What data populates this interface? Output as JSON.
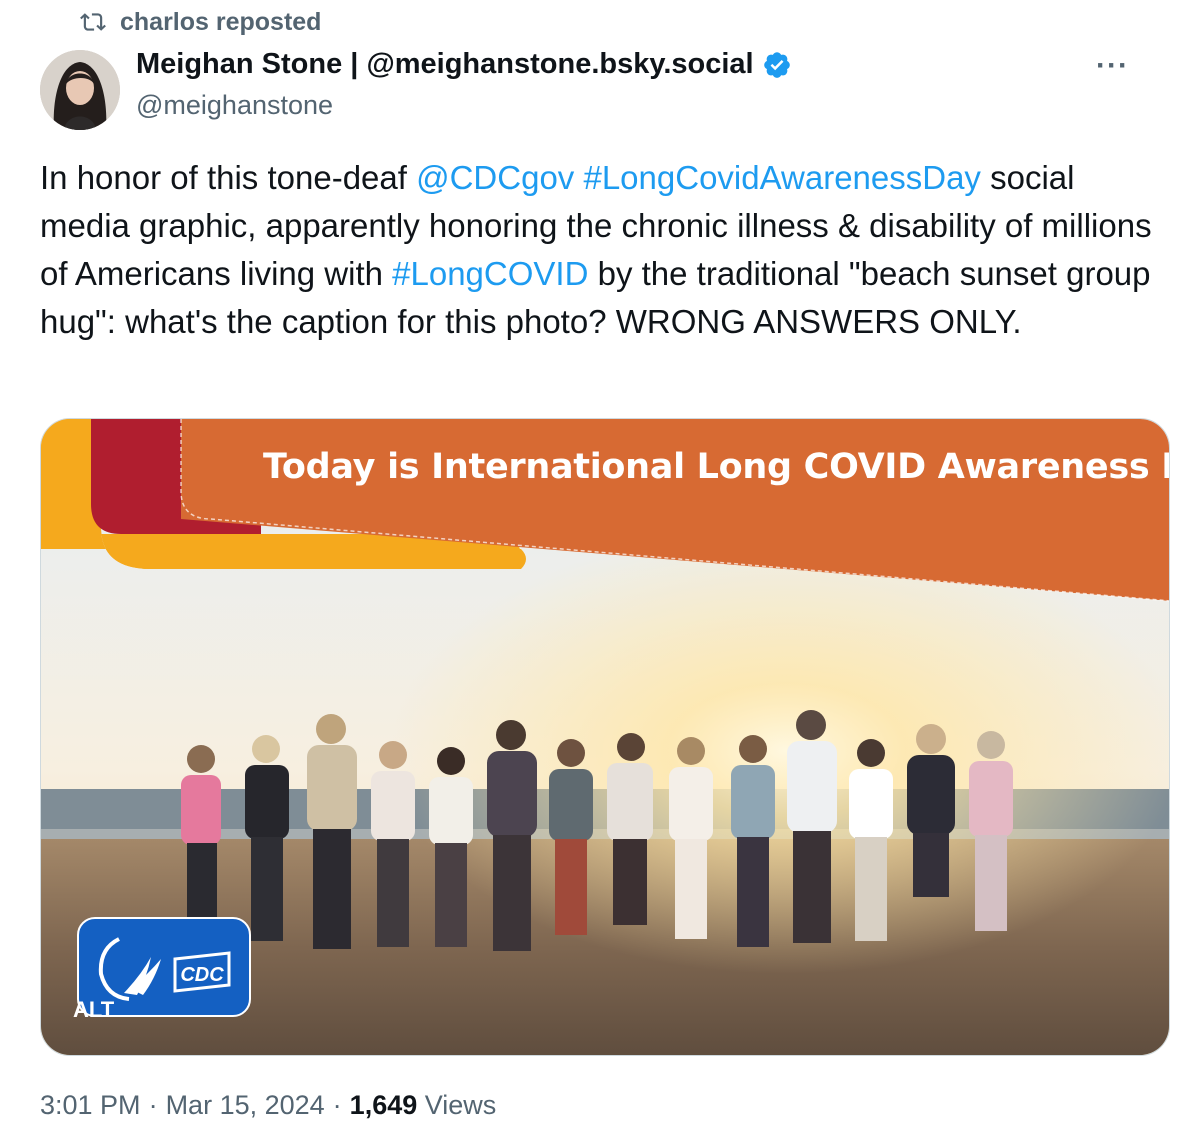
{
  "repost": {
    "label": "charlos reposted"
  },
  "author": {
    "display_name": "Meighan Stone | @meighanstone.bsky.social",
    "handle": "@meighanstone"
  },
  "more_label": "···",
  "tweet": {
    "t1": "In honor of this tone-deaf ",
    "mention": "@CDCgov",
    "t2": " ",
    "hashtag1": "#LongCovidAwarenessDay",
    "t3": " social media graphic, apparently honoring the chronic illness & disability of millions of Americans living with ",
    "hashtag2": "#LongCOVID",
    "t4": " by the traditional \"beach sunset group hug\": what's the caption for this photo? WRONG ANSWERS ONLY."
  },
  "media": {
    "banner_text": "Today is International Long COVID Awareness Day",
    "logo_text": "CDC",
    "alt_label": "ALT"
  },
  "meta": {
    "time": "3:01 PM",
    "sep1": "·",
    "date": "Mar 15, 2024",
    "sep2": "·",
    "views_count": "1,649",
    "views_label": "Views"
  },
  "colors": {
    "link": "#1d9bf0",
    "verified": "#1d9bf0",
    "banner_orange": "#d76a33",
    "banner_red": "#b01e2f",
    "banner_yellow": "#f5a91d",
    "cdc_blue": "#1460c2"
  }
}
